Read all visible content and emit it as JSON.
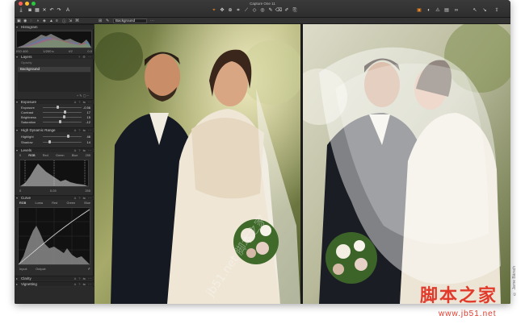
{
  "window": {
    "title": "Capture One 11"
  },
  "toolbar": {
    "left_icons": [
      "import-icon",
      "camera-icon",
      "grid-icon",
      "close-icon",
      "undo-icon",
      "redo-icon",
      "text-icon"
    ],
    "center_icons": [
      "cursor-icon",
      "pan-icon",
      "loupe-icon",
      "crop-icon",
      "straighten-icon",
      "keystone-icon",
      "spot-icon",
      "brush-icon",
      "eraser-icon",
      "picker-icon",
      "copy-icon"
    ],
    "right_icons": [
      "display-icon",
      "exposure-icon",
      "warning-icon",
      "grid-overlay-icon",
      "glasses-icon",
      "copy-adjust-icon",
      "apply-adjust-icon",
      "export-icon"
    ]
  },
  "subbar": {
    "layer_select": "Background"
  },
  "panels": {
    "histogram": {
      "title": "Histogram",
      "iso": "ISO 400",
      "shutter": "1/200 s",
      "aperture": "f/2",
      "ev": "0.0"
    },
    "layers": {
      "title": "Layers",
      "opacity_label": "Opacity",
      "background_layer": "Background"
    },
    "exposure": {
      "title": "Exposure",
      "rows": [
        {
          "label": "Exposure",
          "value": "-0.56"
        },
        {
          "label": "Contrast",
          "value": "17"
        },
        {
          "label": "Brightness",
          "value": "15"
        },
        {
          "label": "Saturation",
          "value": "-12"
        }
      ]
    },
    "hdr": {
      "title": "High Dynamic Range",
      "rows": [
        {
          "label": "Highlight",
          "value": "46"
        },
        {
          "label": "Shadow",
          "value": "14"
        }
      ]
    },
    "levels": {
      "title": "Levels",
      "tabs": [
        "RGB",
        "Red",
        "Green",
        "Blue"
      ],
      "left_value": "0",
      "right_value": "255",
      "bottom_left": "0",
      "bottom_mid": "0.03",
      "bottom_right": "255"
    },
    "curve": {
      "title": "Curve",
      "tabs": [
        "RGB",
        "Luma",
        "Red",
        "Green",
        "Blue"
      ],
      "input_label": "Input:",
      "output_label": "Output:"
    },
    "clarity": {
      "title": "Clarity"
    },
    "vignetting": {
      "title": "Vignetting"
    }
  },
  "credit": "© Jarne Bärsch",
  "branding": {
    "cn_name": "脚本之家",
    "url": "www.jb51.net",
    "watermark": "jb51.net 脚本之家"
  },
  "colors": {
    "accent": "#f08a24",
    "panel_bg": "#2c2c2c",
    "window_bg": "#2a2a2a",
    "brand_red": "#e13a2b"
  }
}
